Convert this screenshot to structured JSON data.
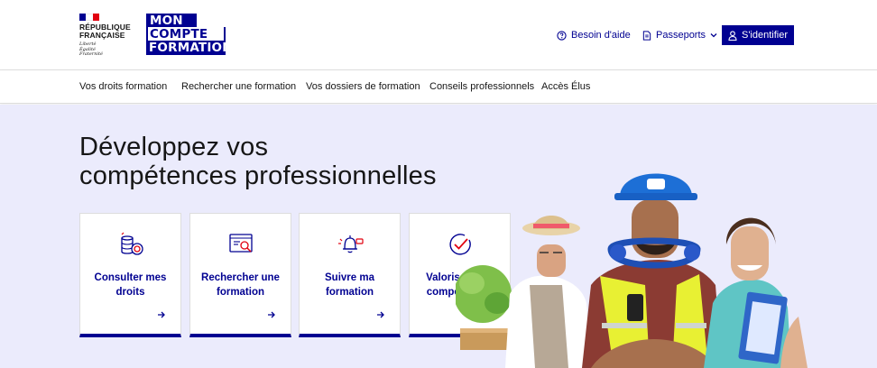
{
  "header": {
    "republic": {
      "name": "RÉPUBLIQUE\nFRANÇAISE",
      "motto": "Liberté\nÉgalité\nFraternité",
      "flag_colors": [
        "#000091",
        "#ffffff",
        "#e1000f"
      ]
    },
    "brand": {
      "line1": "MON",
      "line2": "COMPTE",
      "line3": "FORMATION"
    },
    "help_label": "Besoin d'aide",
    "passports_label": "Passeports",
    "login_label": "S'identifier"
  },
  "nav": {
    "items": [
      "Vos droits formation",
      "Rechercher une formation",
      "Vos dossiers de formation",
      "Conseils professionnels",
      "Accès Élus"
    ]
  },
  "hero": {
    "title_line1": "Développez vos",
    "title_line2": "compétences professionnelles",
    "cards": [
      {
        "label": "Consulter mes droits",
        "icon": "coins-icon",
        "arrow": "arrow-right-icon"
      },
      {
        "label": "Rechercher une formation",
        "icon": "search-screen-icon",
        "arrow": "arrow-right-icon"
      },
      {
        "label": "Suivre ma formation",
        "icon": "bell-icon",
        "arrow": "arrow-right-icon"
      },
      {
        "label": "Valoriser mes compétences",
        "icon": "check-circle-icon",
        "arrow": "external-link-icon"
      }
    ]
  },
  "colors": {
    "primary": "#000091",
    "accent_red": "#e1000f",
    "hero_bg": "#ebebfc"
  }
}
